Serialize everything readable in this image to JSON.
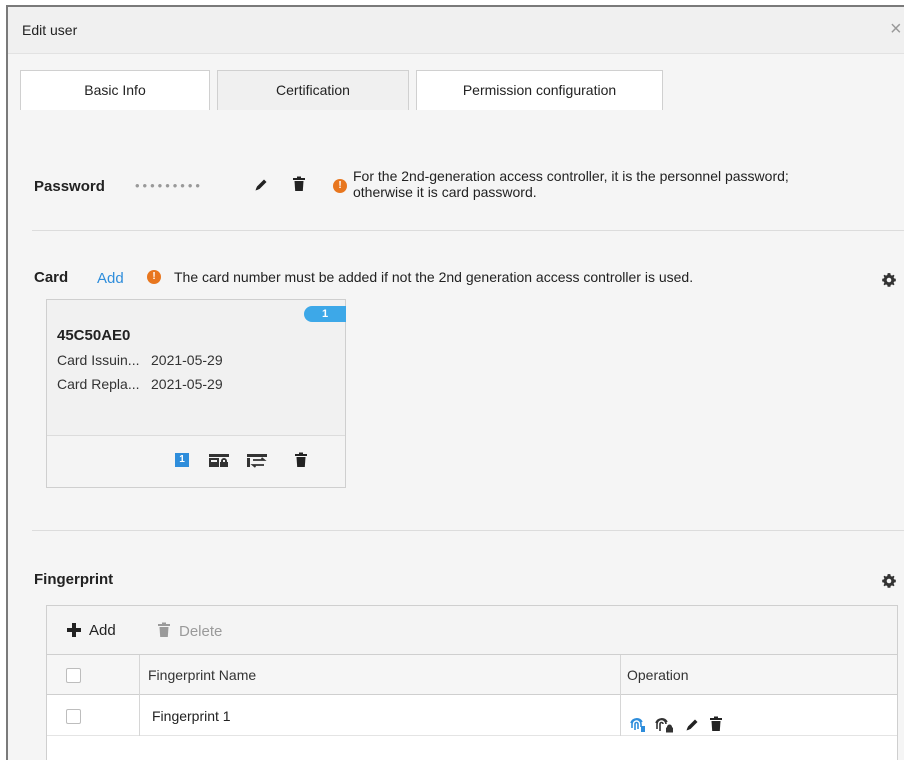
{
  "dialog": {
    "title": "Edit user",
    "close_label": "×"
  },
  "tabs": [
    {
      "label": "Basic Info"
    },
    {
      "label": "Certification"
    },
    {
      "label": "Permission configuration"
    }
  ],
  "password": {
    "label": "Password",
    "masked_value": "•••••••••",
    "hint_line1": "For the 2nd-generation access controller, it is the personnel password;",
    "hint_line2": "otherwise it is card password.",
    "hint_glyph": "!"
  },
  "card": {
    "label": "Card",
    "add_label": "Add",
    "hint": "The card number must be added if not the 2nd generation access controller is used.",
    "hint_glyph": "!",
    "items": [
      {
        "badge": "1",
        "number": "45C50AE0",
        "issuing_label": "Card Issuin...",
        "issuing_date": "2021-05-29",
        "replace_label": "Card Repla...",
        "replace_date": "2021-05-29",
        "index_badge": "1"
      }
    ]
  },
  "fingerprint": {
    "label": "Fingerprint",
    "toolbar": {
      "add_label": "Add",
      "delete_label": "Delete"
    },
    "columns": {
      "name": "Fingerprint Name",
      "operation": "Operation"
    },
    "rows": [
      {
        "name": "Fingerprint 1"
      }
    ]
  },
  "colors": {
    "accent": "#2e8ddb",
    "warning": "#e8761e",
    "badge": "#3da8e8"
  },
  "icons": [
    "close-icon",
    "edit-icon",
    "trash-icon",
    "warning-icon",
    "gear-icon",
    "plus-icon",
    "fingerprint-icon",
    "fingerprint-lock-icon",
    "card-lock-icon",
    "card-replace-icon"
  ]
}
